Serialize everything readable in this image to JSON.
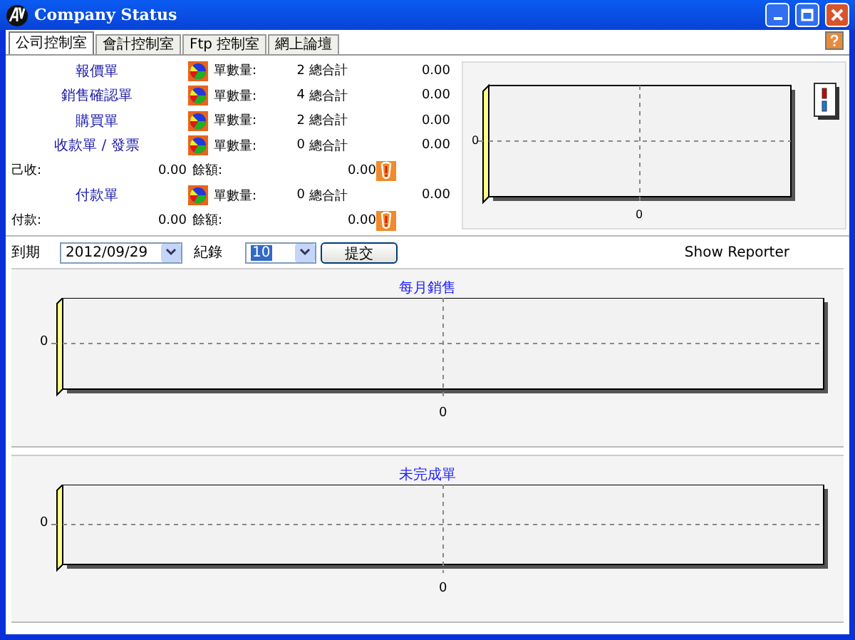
{
  "window": {
    "title": "Company Status"
  },
  "tabs": [
    {
      "label": "公司控制室",
      "selected": true
    },
    {
      "label": "會計控制室",
      "selected": false
    },
    {
      "label": "Ftp 控制室",
      "selected": false
    },
    {
      "label": "網上論壇",
      "selected": false
    }
  ],
  "summary": [
    {
      "kind": "doc",
      "name": "報價單",
      "count_label": "單數量:",
      "count": "2",
      "total_label": "總合計",
      "total": "0.00"
    },
    {
      "kind": "doc",
      "name": "銷售確認單",
      "count_label": "單數量:",
      "count": "4",
      "total_label": "總合計",
      "total": "0.00"
    },
    {
      "kind": "doc",
      "name": "購買單",
      "count_label": "單數量:",
      "count": "2",
      "total_label": "總合計",
      "total": "0.00"
    },
    {
      "kind": "doc",
      "name": "收款單 / 發票",
      "count_label": "單數量:",
      "count": "0",
      "total_label": "總合計",
      "total": "0.00"
    },
    {
      "kind": "balance",
      "label": "己收:",
      "amount": "0.00",
      "balance_label": "餘額:",
      "balance": "0.00"
    },
    {
      "kind": "doc",
      "name": "付款單",
      "count_label": "單數量:",
      "count": "0",
      "total_label": "總合計",
      "total": "0.00"
    },
    {
      "kind": "balance",
      "label": "付款:",
      "amount": "0.00",
      "balance_label": "餘額:",
      "balance": "0.00"
    }
  ],
  "summary_chart": {
    "y_tick": "0",
    "x_tick": "0"
  },
  "filter": {
    "date_label": "到期",
    "date": "2012/09/29",
    "records_label": "紀錄",
    "records": "10",
    "submit": "提交",
    "reporter": "Show Reporter"
  },
  "charts": [
    {
      "title": "每月銷售",
      "y_tick": "0",
      "x_tick": "0"
    },
    {
      "title": "未完成單",
      "y_tick": "0",
      "x_tick": "0"
    }
  ]
}
